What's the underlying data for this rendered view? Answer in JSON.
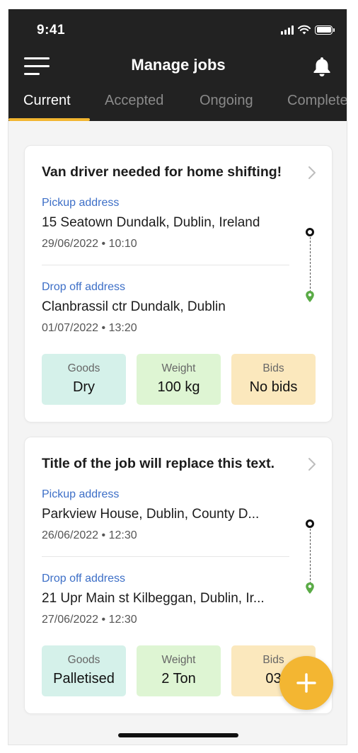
{
  "status_bar": {
    "time": "9:41"
  },
  "header": {
    "title": "Manage jobs"
  },
  "tabs": [
    {
      "label": "Current",
      "active": true
    },
    {
      "label": "Accepted",
      "active": false
    },
    {
      "label": "Ongoing",
      "active": false
    },
    {
      "label": "Complete",
      "active": false
    }
  ],
  "jobs": [
    {
      "title": "Van driver needed for home shifting!",
      "pickup": {
        "label": "Pickup address",
        "address": "15 Seatown Dundalk, Dublin, Ireland",
        "datetime": "29/06/2022 • 10:10"
      },
      "dropoff": {
        "label": "Drop off address",
        "address": "Clanbrassil ctr Dundalk, Dublin",
        "datetime": "01/07/2022 • 13:20"
      },
      "stats": {
        "goods": {
          "label": "Goods",
          "value": "Dry"
        },
        "weight": {
          "label": "Weight",
          "value": "100 kg"
        },
        "bids": {
          "label": "Bids",
          "value": "No bids"
        }
      }
    },
    {
      "title": "Title of the job will replace this text.",
      "pickup": {
        "label": "Pickup address",
        "address": "Parkview House, Dublin, County D...",
        "datetime": "26/06/2022 • 12:30"
      },
      "dropoff": {
        "label": "Drop off address",
        "address": "21 Upr Main st Kilbeggan, Dublin, Ir...",
        "datetime": "27/06/2022 • 12:30"
      },
      "stats": {
        "goods": {
          "label": "Goods",
          "value": "Palletised"
        },
        "weight": {
          "label": "Weight",
          "value": "2 Ton"
        },
        "bids": {
          "label": "Bids",
          "value": "03"
        }
      }
    }
  ],
  "icons": {
    "menu": "menu-icon",
    "bell": "bell-icon",
    "chevron": "chevron-right-icon",
    "fab": "plus-icon"
  },
  "colors": {
    "header_bg": "#222222",
    "accent": "#f2b530",
    "link_blue": "#3d6fc7",
    "pin_green": "#5aab46",
    "goods_bg": "#d5f1ea",
    "weight_bg": "#def5d3",
    "bids_bg": "#fbe8bd"
  }
}
